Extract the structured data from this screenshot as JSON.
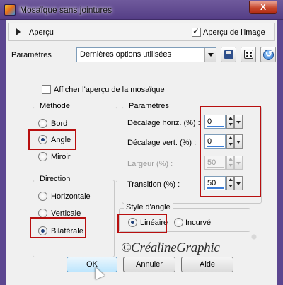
{
  "window": {
    "title": "Mosaïque sans jointures",
    "close_label": "X"
  },
  "preview": {
    "expander_label": "Aperçu",
    "show_image_label": "Aperçu de l'image",
    "show_image_checked": true
  },
  "settings": {
    "label": "Paramètres",
    "preset_value": "Dernières options utilisées"
  },
  "tiling_preview": {
    "label": "Afficher l'aperçu de la mosaïque",
    "checked": false
  },
  "method": {
    "title": "Méthode",
    "options": [
      "Bord",
      "Angle",
      "Miroir"
    ],
    "selected": "Angle"
  },
  "params": {
    "title": "Paramètres",
    "rows": [
      {
        "label": "Décalage horiz. (%) :",
        "value": "0",
        "enabled": true
      },
      {
        "label": "Décalage vert. (%) :",
        "value": "0",
        "enabled": true
      },
      {
        "label": "Largeur (%) :",
        "value": "50",
        "enabled": false
      },
      {
        "label": "Transition (%) :",
        "value": "50",
        "enabled": true
      }
    ]
  },
  "direction": {
    "title": "Direction",
    "options": [
      "Horizontale",
      "Verticale",
      "Bilatérale"
    ],
    "selected": "Bilatérale"
  },
  "corner_style": {
    "title": "Style d'angle",
    "options": [
      "Linéaire",
      "Incurvé"
    ],
    "selected": "Linéaire"
  },
  "buttons": {
    "ok": "OK",
    "cancel": "Annuler",
    "help": "Aide"
  },
  "watermark": "©CréalineGraphic",
  "colors": {
    "title_bar": "#553e86",
    "highlight": "#b80f0f",
    "spinner_bar": "#3c7ed8"
  }
}
